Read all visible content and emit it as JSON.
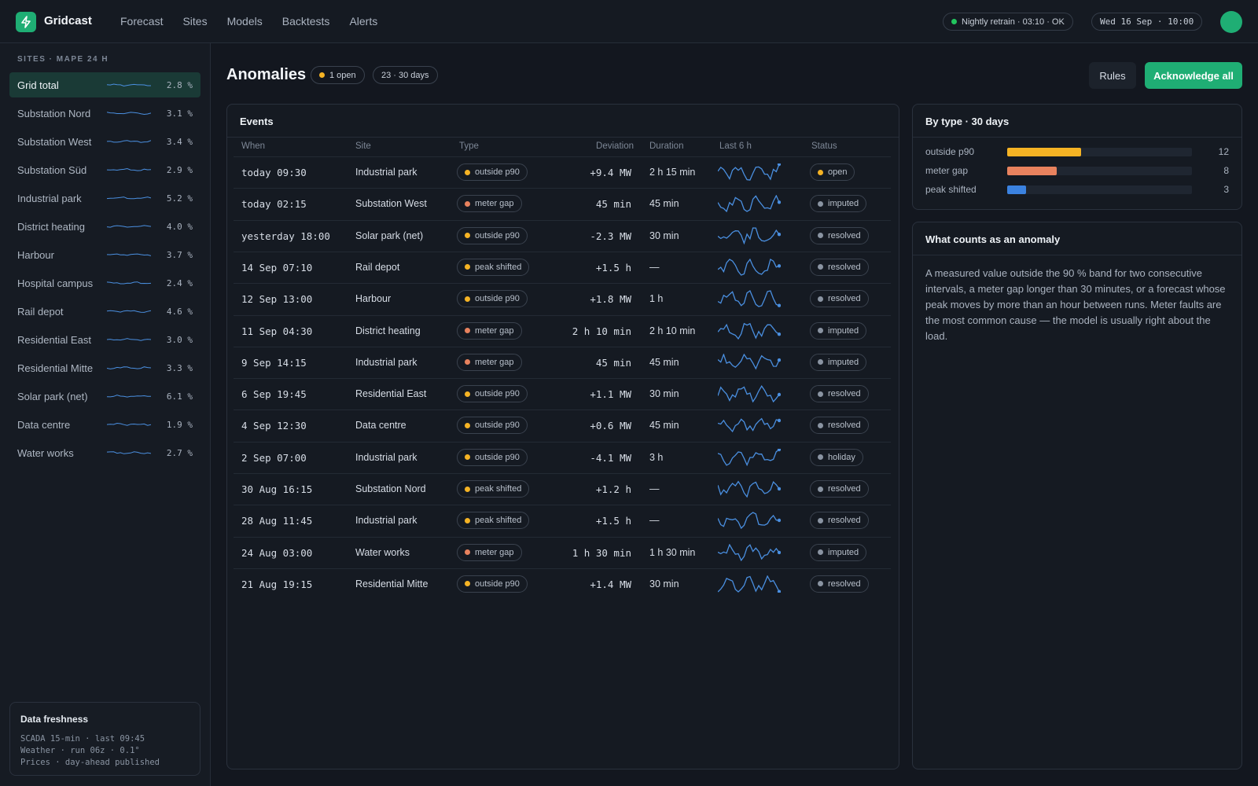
{
  "app": {
    "brand": "Gridcast"
  },
  "nav": [
    "Forecast",
    "Sites",
    "Models",
    "Backtests",
    "Alerts"
  ],
  "status": {
    "retrain": "Nightly retrain · 03:10 · OK",
    "datetime": "Wed 16 Sep · 10:00"
  },
  "sidebar": {
    "heading": "SITES · MAPE 24 H",
    "sites": [
      {
        "name": "Grid total",
        "value": "2.8 %",
        "active": true
      },
      {
        "name": "Substation Nord",
        "value": "3.1 %"
      },
      {
        "name": "Substation West",
        "value": "3.4 %"
      },
      {
        "name": "Substation Süd",
        "value": "2.9 %"
      },
      {
        "name": "Industrial park",
        "value": "5.2 %"
      },
      {
        "name": "District heating",
        "value": "4.0 %"
      },
      {
        "name": "Harbour",
        "value": "3.7 %"
      },
      {
        "name": "Hospital campus",
        "value": "2.4 %"
      },
      {
        "name": "Rail depot",
        "value": "4.6 %"
      },
      {
        "name": "Residential East",
        "value": "3.0 %"
      },
      {
        "name": "Residential Mitte",
        "value": "3.3 %"
      },
      {
        "name": "Solar park (net)",
        "value": "6.1 %"
      },
      {
        "name": "Data centre",
        "value": "1.9 %"
      },
      {
        "name": "Water works",
        "value": "2.7 %"
      }
    ],
    "freshness": {
      "title": "Data freshness",
      "lines": [
        "SCADA 15-min · last 09:45",
        "Weather · run 06z · 0.1°",
        "Prices · day-ahead published"
      ]
    }
  },
  "page": {
    "title": "Anomalies",
    "open_badge": "1 open",
    "count_badge": "23 · 30 days",
    "rules_button": "Rules",
    "ack_button": "Acknowledge all"
  },
  "events": {
    "title": "Events",
    "columns": [
      "When",
      "Site",
      "Type",
      "Deviation",
      "Duration",
      "Last 6 h",
      "Status"
    ],
    "rows": [
      {
        "when": "today 09:30",
        "site": "Industrial park",
        "type": "outside p90",
        "deviation": "+9.4 MW",
        "duration": "2 h 15 min",
        "status": "open"
      },
      {
        "when": "today 02:15",
        "site": "Substation West",
        "type": "meter gap",
        "deviation": "45 min",
        "duration": "45 min",
        "status": "imputed"
      },
      {
        "when": "yesterday 18:00",
        "site": "Solar park (net)",
        "type": "outside p90",
        "deviation": "-2.3 MW",
        "duration": "30 min",
        "status": "resolved"
      },
      {
        "when": "14 Sep 07:10",
        "site": "Rail depot",
        "type": "peak shifted",
        "deviation": "+1.5 h",
        "duration": "—",
        "status": "resolved"
      },
      {
        "when": "12 Sep 13:00",
        "site": "Harbour",
        "type": "outside p90",
        "deviation": "+1.8 MW",
        "duration": "1 h",
        "status": "resolved"
      },
      {
        "when": "11 Sep 04:30",
        "site": "District heating",
        "type": "meter gap",
        "deviation": "2 h 10 min",
        "duration": "2 h 10 min",
        "status": "imputed"
      },
      {
        "when": "9 Sep 14:15",
        "site": "Industrial park",
        "type": "meter gap",
        "deviation": "45 min",
        "duration": "45 min",
        "status": "imputed"
      },
      {
        "when": "6 Sep 19:45",
        "site": "Residential East",
        "type": "outside p90",
        "deviation": "+1.1 MW",
        "duration": "30 min",
        "status": "resolved"
      },
      {
        "when": "4 Sep 12:30",
        "site": "Data centre",
        "type": "outside p90",
        "deviation": "+0.6 MW",
        "duration": "45 min",
        "status": "resolved"
      },
      {
        "when": "2 Sep 07:00",
        "site": "Industrial park",
        "type": "outside p90",
        "deviation": "-4.1 MW",
        "duration": "3 h",
        "status": "holiday"
      },
      {
        "when": "30 Aug 16:15",
        "site": "Substation Nord",
        "type": "peak shifted",
        "deviation": "+1.2 h",
        "duration": "—",
        "status": "resolved"
      },
      {
        "when": "28 Aug 11:45",
        "site": "Industrial park",
        "type": "peak shifted",
        "deviation": "+1.5 h",
        "duration": "—",
        "status": "resolved"
      },
      {
        "when": "24 Aug 03:00",
        "site": "Water works",
        "type": "meter gap",
        "deviation": "1 h 30 min",
        "duration": "1 h 30 min",
        "status": "imputed"
      },
      {
        "when": "21 Aug 19:15",
        "site": "Residential Mitte",
        "type": "outside p90",
        "deviation": "+1.4 MW",
        "duration": "30 min",
        "status": "resolved"
      }
    ]
  },
  "by_type": {
    "title": "By type · 30 days",
    "max": 30,
    "items": [
      {
        "label": "outside p90",
        "count": 12,
        "color": "#f5b324"
      },
      {
        "label": "meter gap",
        "count": 8,
        "color": "#e8825e"
      },
      {
        "label": "peak shifted",
        "count": 3,
        "color": "#3b82e0"
      }
    ]
  },
  "definition": {
    "title": "What counts as an anomaly",
    "text": "A measured value outside the 90 % band for two consecutive intervals, a meter gap longer than 30 minutes, or a forecast whose peak moves by more than an hour between runs. Meter faults are the most common cause — the model is usually right about the load."
  },
  "colors": {
    "accent": "#1fae74",
    "outside p90": "#f5b324",
    "meter gap": "#e8825e",
    "peak shifted": "#f5b324",
    "open": "#f5b324",
    "imputed": "#8a94a2",
    "resolved": "#8a94a2",
    "holiday": "#8a94a2",
    "spark": "#4a8fe0"
  }
}
